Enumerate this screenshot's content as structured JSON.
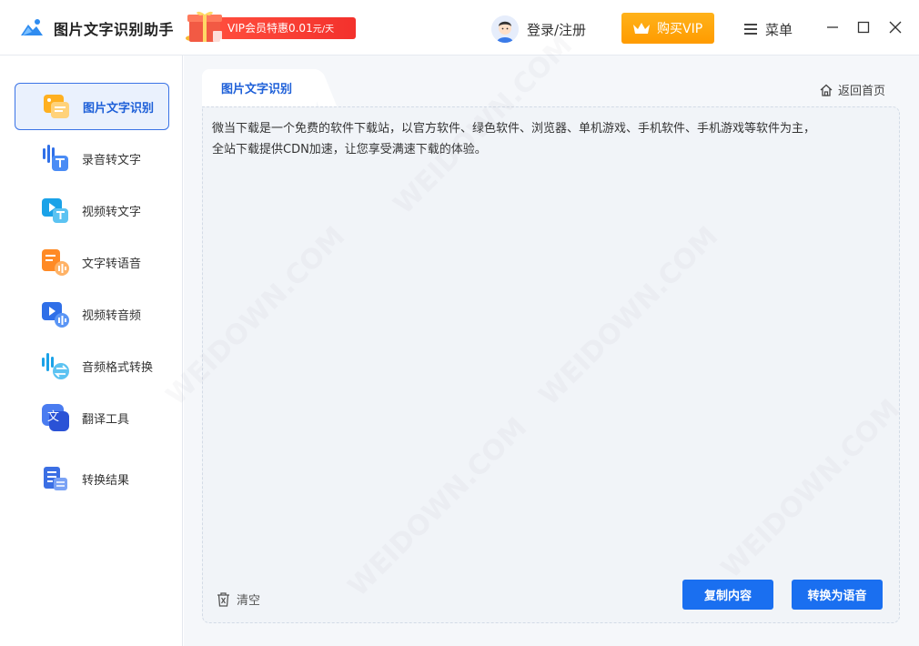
{
  "app": {
    "title": "图片文字识别助手",
    "promo_text": "VIP会员特惠0.01",
    "promo_unit": "元/天"
  },
  "header": {
    "login_label": "登录/注册",
    "vip_label": "购买VIP",
    "menu_label": "菜单"
  },
  "sidebar": {
    "items": [
      {
        "label": "图片文字识别",
        "icon": "image-text-icon",
        "active": true
      },
      {
        "label": "录音转文字",
        "icon": "audio-to-text-icon"
      },
      {
        "label": "视频转文字",
        "icon": "video-to-text-icon"
      },
      {
        "label": "文字转语音",
        "icon": "text-to-speech-icon"
      },
      {
        "label": "视频转音频",
        "icon": "video-to-audio-icon"
      },
      {
        "label": "音频格式转换",
        "icon": "audio-convert-icon"
      },
      {
        "label": "翻译工具",
        "icon": "translate-icon"
      },
      {
        "label": "转换结果",
        "icon": "results-icon"
      }
    ]
  },
  "main": {
    "tab_label": "图片文字识别",
    "home_label": "返回首页",
    "content_line1": "微当下载是一个免费的软件下载站，以官方软件、绿色软件、浏览器、单机游戏、手机软件、手机游戏等软件为主，",
    "content_line2": "全站下载提供CDN加速，让您享受满速下载的体验。",
    "clear_label": "清空",
    "copy_label": "复制内容",
    "convert_label": "转换为语音"
  },
  "watermark": "WEIDOWN.COM",
  "colors": {
    "accent": "#1a6ff0",
    "vip": "#ffa20a",
    "promo": "#f3312c"
  }
}
